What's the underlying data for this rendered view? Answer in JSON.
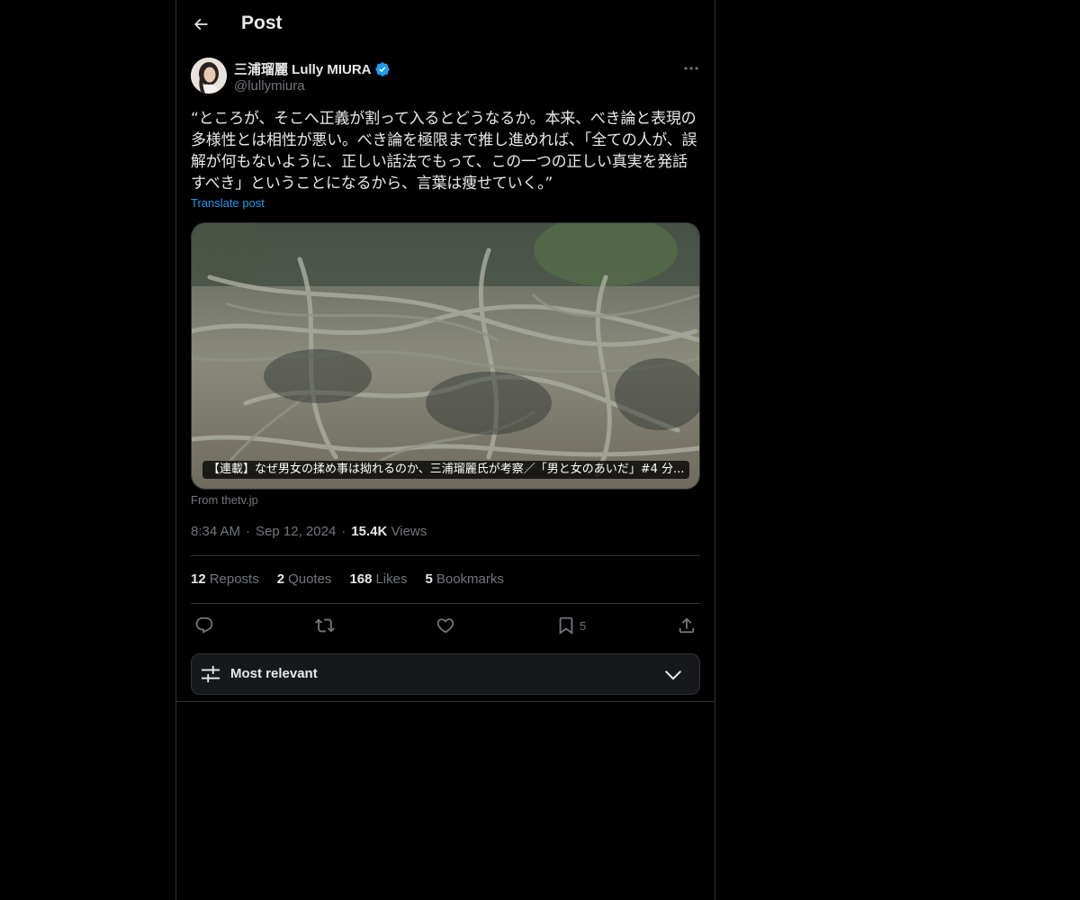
{
  "header": {
    "title": "Post"
  },
  "post": {
    "author_name": "三浦瑠麗 Lully MIURA",
    "handle": "@lullymiura",
    "text": "“ところが、そこへ正義が割って入るとどうなるか。本来、べき論と表現の多様性とは相性が悪い。べき論を極限まで推し進めれば、「全ての人が、誤解が何もないように、正しい話法でもって、この一つの正しい真実を発話すべき」ということになるから、言葉は痩せていく。”",
    "translate_label": "Translate post",
    "card": {
      "caption": "【連載】なぜ男女の揉め事は拗れるのか、三浦瑠麗氏が考察／「男と女のあいだ」#4 分...",
      "source": "From thetv.jp"
    },
    "time": "8:34 AM",
    "date": "Sep 12, 2024",
    "views_count": "15.4K",
    "views_label": "Views",
    "stats": [
      {
        "count": "12",
        "label": "Reposts"
      },
      {
        "count": "2",
        "label": "Quotes"
      },
      {
        "count": "168",
        "label": "Likes"
      },
      {
        "count": "5",
        "label": "Bookmarks"
      }
    ],
    "actions": {
      "bookmark_count": "5"
    }
  },
  "replies": {
    "sort_label": "Most relevant"
  },
  "colors": {
    "background": "#000000",
    "text": "#e7e9ea",
    "secondary": "#71767b",
    "accent": "#1d9bf0",
    "border": "#2f3336"
  },
  "icons": {
    "back": "arrow-left-icon",
    "verified": "verified-badge-icon",
    "more": "more-horizontal-icon",
    "reply": "reply-icon",
    "repost": "repost-icon",
    "like": "heart-icon",
    "bookmark": "bookmark-icon",
    "share": "share-icon",
    "sort": "sliders-icon",
    "chevron": "chevron-down-icon"
  }
}
